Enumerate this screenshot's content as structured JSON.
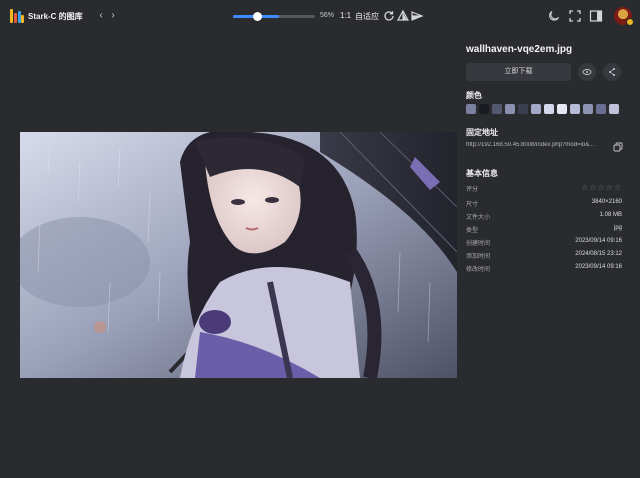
{
  "app": {
    "title": "Stark-C 的图库"
  },
  "toolbar": {
    "zoom_percent": "56%",
    "zoom_level": 0.56,
    "actual_size_label": "1:1",
    "fit_label": "自适应",
    "icons": [
      "chevron-left-icon",
      "chevron-right-icon",
      "rotate-icon",
      "flip-vertical-icon",
      "flip-horizontal-icon",
      "moon-icon",
      "fullscreen-icon",
      "panel-toggle-icon"
    ]
  },
  "image": {
    "description_icon": "anime-girl-umbrella-rain"
  },
  "panel": {
    "file_name": "wallhaven-vqe2em.jpg",
    "download_label": "立即下载",
    "colors_title": "颜色",
    "colors": [
      "#7b7fa0",
      "#1a1a22",
      "#545870",
      "#8c90b0",
      "#3c3e52",
      "#a4a8c8",
      "#d4d8ec",
      "#e6e8f4",
      "#b8bcd8",
      "#9094b4",
      "#6a6e92",
      "#c0c2da"
    ],
    "address_title": "固定地址",
    "address_url": "http://192.168.50.45:8008/index.php?mod=io&...",
    "info_title": "基本信息",
    "info": {
      "rating_label": "评分",
      "rating_stars": "☆☆☆☆☆",
      "size_label": "尺寸",
      "size_value": "3840×2160",
      "filesize_label": "文件大小",
      "filesize_value": "1.08 MB",
      "type_label": "类型",
      "type_value": "jpg",
      "created_label": "创建时间",
      "created_value": "2023/09/14 09:16",
      "added_label": "添加时间",
      "added_value": "2024/08/15 23:12",
      "modified_label": "修改时间",
      "modified_value": "2023/09/14 09:16"
    }
  },
  "accent": "#3d8bff"
}
